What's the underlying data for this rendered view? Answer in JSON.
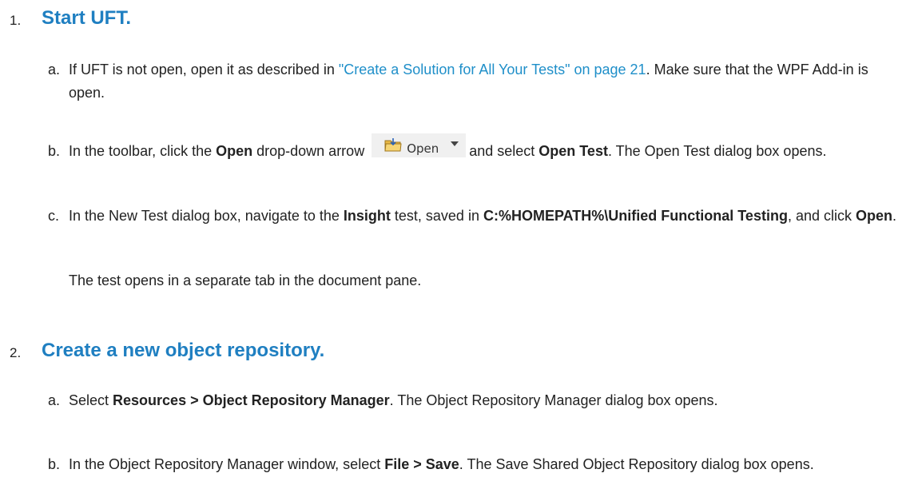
{
  "steps": [
    {
      "number": "1.",
      "title": "Start UFT.",
      "items": [
        {
          "letter": "a.",
          "text1": "If UFT is not open, open it as described in ",
          "link": "\"Create a Solution for All Your Tests\" on page 21",
          "text2": ". Make sure that the WPF Add-in is open."
        },
        {
          "letter": "b.",
          "text1": "In the toolbar, click the ",
          "bold1": "Open",
          "text2": " drop-down arrow",
          "button_label": "Open",
          "text3": "and select ",
          "bold2": "Open Test",
          "text4": ". The Open Test dialog box opens."
        },
        {
          "letter": "c.",
          "text1": "In the New Test dialog box, navigate to the ",
          "bold1": "Insight",
          "text2": " test, saved in ",
          "bold2": "C:%HOMEPATH%\\Unified Functional Testing",
          "text3": ", and click ",
          "bold3": "Open",
          "text4": "."
        }
      ],
      "note": "The test opens in a separate tab in the document pane."
    },
    {
      "number": "2.",
      "title": "Create a new object repository.",
      "items": [
        {
          "letter": "a.",
          "text1": "Select ",
          "bold1": "Resources > Object Repository Manager",
          "text2": ". The Object Repository Manager dialog box opens."
        },
        {
          "letter": "b.",
          "text1": "In the Object Repository Manager window, select ",
          "bold1": "File > Save",
          "text2": ". The Save Shared Object Repository dialog box opens."
        }
      ]
    }
  ],
  "icons": {
    "open_button_icon": "open-folder-icon",
    "dropdown_icon": "chevron-down-icon"
  },
  "colors": {
    "heading": "#1f7fc1",
    "link": "#1f8fc9",
    "text": "#222222",
    "toolbar_button_bg": "#f0f0f0"
  }
}
